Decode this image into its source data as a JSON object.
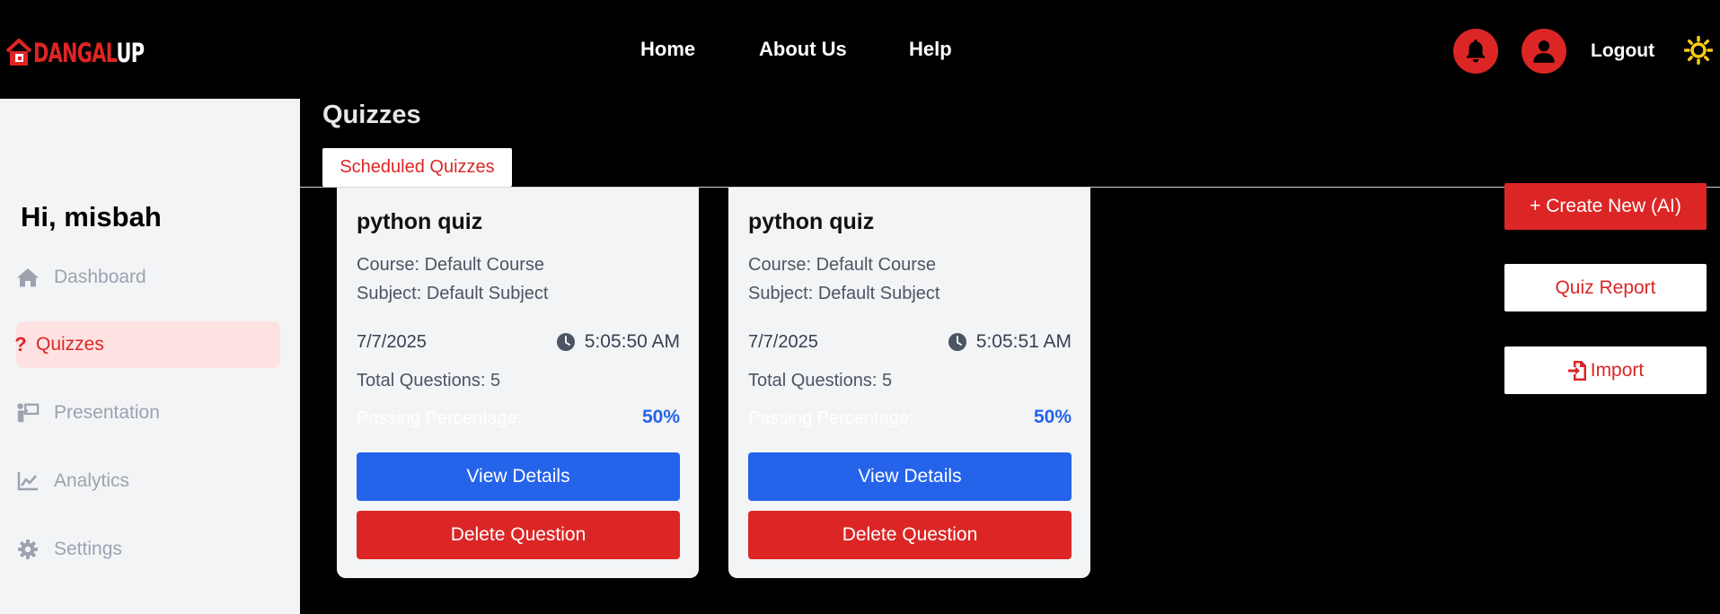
{
  "brand": {
    "part1": "DANGAL",
    "part2": "UP",
    "accent": "#e02424"
  },
  "nav": {
    "home": "Home",
    "about": "About Us",
    "help": "Help"
  },
  "header": {
    "logout": "Logout",
    "notification_icon": "bell-icon",
    "profile_icon": "user-icon",
    "theme_icon": "sun-icon"
  },
  "sidebar": {
    "greeting": "Hi, misbah",
    "items": [
      {
        "label": "Dashboard",
        "icon": "home-icon",
        "active": false
      },
      {
        "label": "Quizzes",
        "icon": "question-icon",
        "active": true
      },
      {
        "label": "Presentation",
        "icon": "presentation-icon",
        "active": false
      },
      {
        "label": "Analytics",
        "icon": "chart-line-icon",
        "active": false
      },
      {
        "label": "Settings",
        "icon": "gear-icon",
        "active": false
      }
    ]
  },
  "main": {
    "title": "Quizzes",
    "tab": "Scheduled Quizzes",
    "cards": [
      {
        "title": "python quiz",
        "course": "Course: Default Course",
        "subject": "Subject: Default Subject",
        "date": "7/7/2025",
        "time": "5:05:50 AM",
        "total": "Total Questions: 5",
        "pass_label": "Passing Percentage:",
        "pass_value": "50%",
        "view": "View Details",
        "delete": "Delete Question"
      },
      {
        "title": "python quiz",
        "course": "Course: Default Course",
        "subject": "Subject: Default Subject",
        "date": "7/7/2025",
        "time": "5:05:51 AM",
        "total": "Total Questions: 5",
        "pass_label": "Passing Percentage:",
        "pass_value": "50%",
        "view": "View Details",
        "delete": "Delete Question"
      }
    ]
  },
  "actions": {
    "create": "+ Create New (AI)",
    "report": "Quiz Report",
    "import": "Import"
  },
  "colors": {
    "primary_red": "#dc2626",
    "primary_blue": "#2563eb",
    "sidebar_bg": "#f3f4f6",
    "active_bg": "#fee2e2"
  }
}
